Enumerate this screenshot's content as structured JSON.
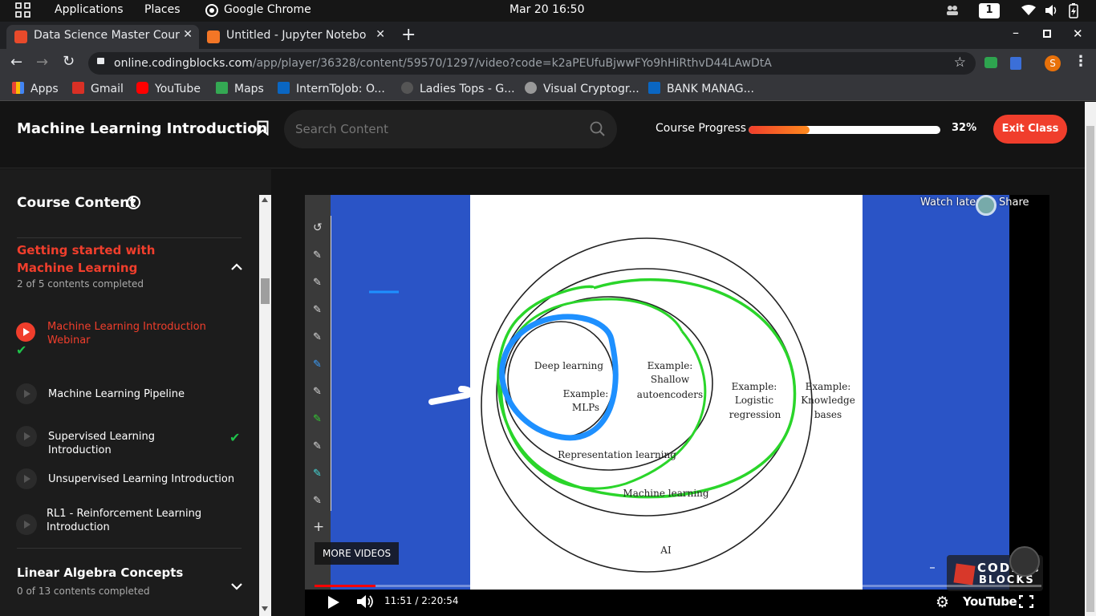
{
  "gnome": {
    "applications": "Applications",
    "places": "Places",
    "app": "Google Chrome",
    "clock": "Mar 20  16:50",
    "workspace": "1"
  },
  "tabs": [
    {
      "title": "Data Science Master Cour",
      "active": true
    },
    {
      "title": "Untitled - Jupyter Notebo",
      "active": false
    }
  ],
  "omnibox": {
    "host": "online.codingblocks.com",
    "path": "/app/player/36328/content/59570/1297/video?code=k2aPEUfuBjwwFYo9hHiRthvD44LAwDtA"
  },
  "profile_initial": "S",
  "bookmarks": [
    "Apps",
    "Gmail",
    "YouTube",
    "Maps",
    "InternToJob: O...",
    "Ladies Tops - G...",
    "Visual Cryptogr...",
    "BANK MANAG..."
  ],
  "header": {
    "title": "Machine Learning Introduction",
    "search_placeholder": "Search Content",
    "progress_label": "Course Progress",
    "progress_percent": "32%",
    "progress_value": 0.32,
    "exit_label": "Exit Class"
  },
  "sidebar": {
    "title": "Course Content",
    "section1": {
      "title": "Getting started with Machine Learning",
      "meta": "2 of 5 contents completed"
    },
    "lessons": [
      {
        "title": "Machine Learning Introduction Webinar",
        "active": true,
        "done": true
      },
      {
        "title": "Machine Learning Pipeline",
        "active": false,
        "done": false
      },
      {
        "title": "Supervised Learning Introduction",
        "active": false,
        "done": true
      },
      {
        "title": "Unsupervised Learning Introduction",
        "active": false,
        "done": false
      },
      {
        "title": "RL1 - Reinforcement Learning Introduction",
        "active": false,
        "done": false
      }
    ],
    "section2": {
      "title": "Linear Algebra Concepts",
      "meta": "0 of 13 contents completed"
    }
  },
  "video": {
    "watch_later": "Watch later",
    "share": "Share",
    "more_videos": "MORE VIDEOS",
    "time": "11:51 / 2:20:54",
    "played_fraction": 0.084,
    "youtube": "YouTube",
    "brand1": "CODING",
    "brand2": "BLOCKS",
    "diagram": {
      "deep_learning": "Deep learning",
      "mlp1": "Example:",
      "mlp2": "MLPs",
      "shallow1": "Example:",
      "shallow2": "Shallow",
      "shallow3": "autoencoders",
      "rep": "Representation learning",
      "log1": "Example:",
      "log2": "Logistic",
      "log3": "regression",
      "kb1": "Example:",
      "kb2": "Knowledge",
      "kb3": "bases",
      "ml": "Machine learning",
      "ai": "AI"
    }
  },
  "colors": {
    "accent": "#f03e2c",
    "progress_start": "#f03e2c",
    "progress_end": "#ff8b1e",
    "check": "#1fc24a"
  }
}
